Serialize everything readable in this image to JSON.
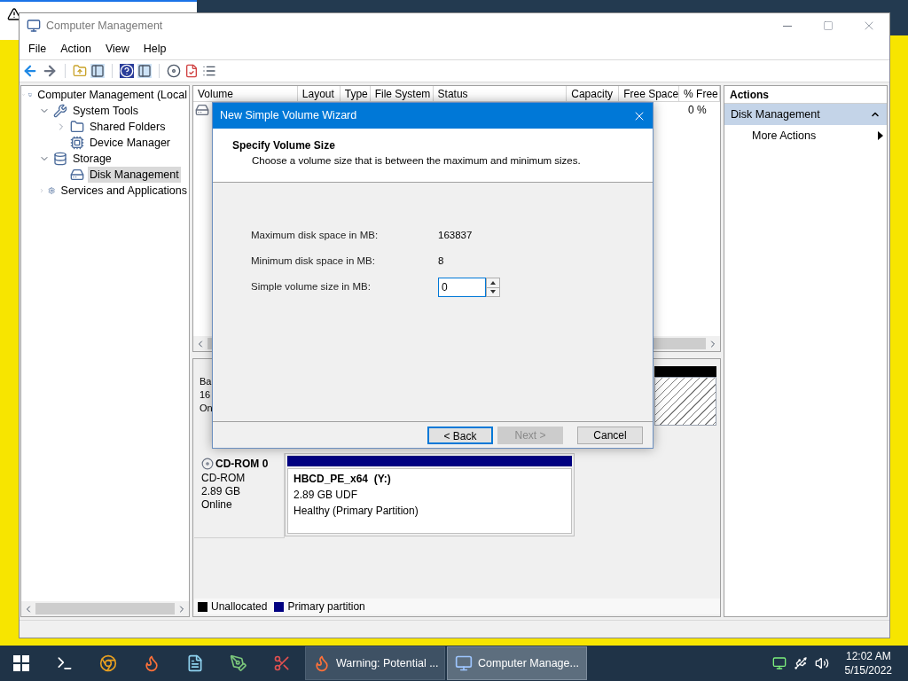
{
  "window": {
    "title": "Computer Management",
    "menu": [
      "File",
      "Action",
      "View",
      "Help"
    ]
  },
  "tree": [
    {
      "label": "Computer Management (Local",
      "selected": false,
      "expanded": true,
      "children": [
        {
          "label": "System Tools",
          "selected": false,
          "expanded": true,
          "children": [
            {
              "label": "Shared Folders",
              "selected": false,
              "expanded": false
            },
            {
              "label": "Device Manager",
              "selected": false
            }
          ]
        },
        {
          "label": "Storage",
          "selected": false,
          "expanded": true,
          "children": [
            {
              "label": "Disk Management",
              "selected": true
            }
          ]
        },
        {
          "label": "Services and Applications",
          "selected": false,
          "expanded": false
        }
      ]
    }
  ],
  "volume_table": {
    "columns": [
      "Volume",
      "Layout",
      "Type",
      "File System",
      "Status",
      "Capacity",
      "Free Space",
      "% Free"
    ],
    "rows": [
      {
        "percent_free": "0 %"
      }
    ]
  },
  "disks": [
    {
      "kind": "basic",
      "lines": [
        "Ba",
        "16",
        "On"
      ]
    },
    {
      "kind": "cdrom",
      "name": "CD-ROM 0",
      "lines": [
        "CD-ROM",
        "2.89 GB",
        "Online"
      ],
      "partitions": [
        {
          "name": "HBCD_PE_x64  (Y:)",
          "detail": "2.89 GB UDF",
          "status": "Healthy (Primary Partition)",
          "color": "#000080"
        }
      ]
    }
  ],
  "legend": [
    {
      "label": "Unallocated",
      "color": "#000000"
    },
    {
      "label": "Primary partition",
      "color": "#000080"
    }
  ],
  "actions": {
    "title": "Actions",
    "items": [
      {
        "kind": "header",
        "label": "Disk Management",
        "expanded": true
      },
      {
        "kind": "submenu",
        "label": "More Actions"
      }
    ]
  },
  "dialog": {
    "title": "New Simple Volume Wizard",
    "heading": "Specify Volume Size",
    "subheading": "Choose a volume size that is between the maximum and minimum sizes.",
    "fields": [
      {
        "kind": "readout",
        "label": "Maximum disk space in MB:",
        "value": "163837"
      },
      {
        "kind": "readout",
        "label": "Minimum disk space in MB:",
        "value": "8"
      },
      {
        "kind": "spinner",
        "label": "Simple volume size in MB:",
        "value": "0"
      }
    ],
    "buttons": [
      {
        "label": "< Back",
        "disabled": false,
        "focused": true
      },
      {
        "label": "Next >",
        "disabled": true,
        "focused": false
      },
      {
        "label": "Cancel",
        "disabled": false,
        "focused": false
      }
    ]
  },
  "taskbar": {
    "windows": [
      {
        "label": "Warning: Potential ...",
        "selected": false
      },
      {
        "label": "Computer Manage...",
        "selected": true
      }
    ],
    "time": "12:02 AM",
    "date": "5/15/2022"
  }
}
